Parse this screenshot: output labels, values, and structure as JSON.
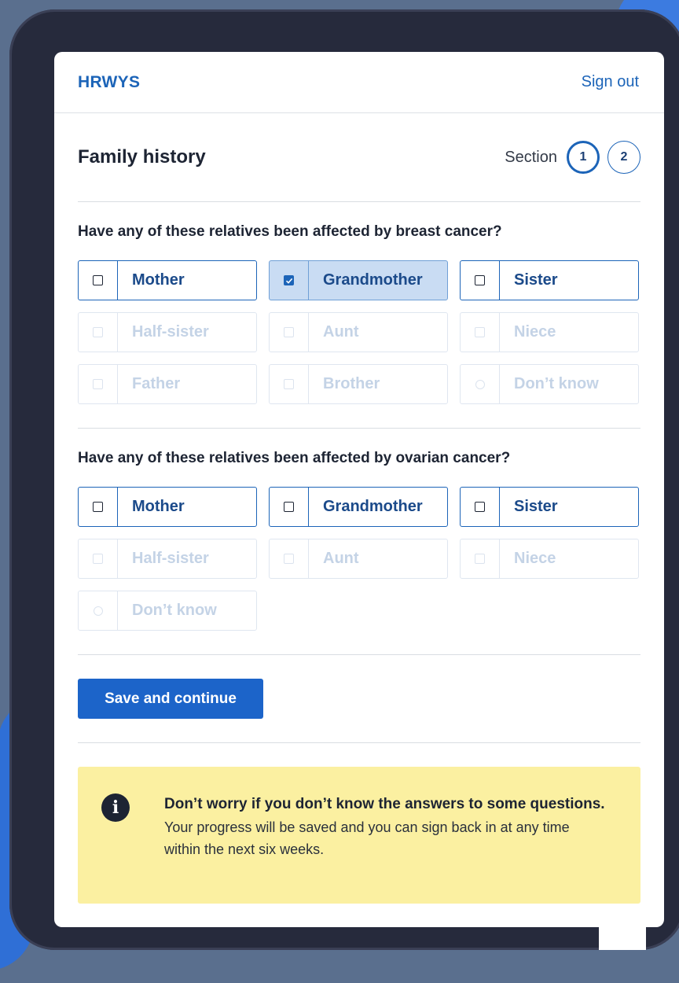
{
  "header": {
    "brand": "HRWYS",
    "sign_out": "Sign out"
  },
  "page": {
    "title": "Family history",
    "section_label": "Section",
    "steps": [
      {
        "number": "1",
        "current": true
      },
      {
        "number": "2",
        "current": false
      }
    ]
  },
  "questions": [
    {
      "text": "Have any of these relatives been affected by breast cancer?",
      "options": [
        {
          "label": "Mother",
          "state": "unchecked"
        },
        {
          "label": "Grandmother",
          "state": "checked"
        },
        {
          "label": "Sister",
          "state": "unchecked"
        },
        {
          "label": "Half-sister",
          "state": "disabled"
        },
        {
          "label": "Aunt",
          "state": "disabled"
        },
        {
          "label": "Niece",
          "state": "disabled"
        },
        {
          "label": "Father",
          "state": "disabled"
        },
        {
          "label": "Brother",
          "state": "disabled"
        },
        {
          "label": "Don’t know",
          "state": "disabled-radio"
        }
      ]
    },
    {
      "text": "Have any of these relatives been affected by ovarian cancer?",
      "options": [
        {
          "label": "Mother",
          "state": "unchecked"
        },
        {
          "label": "Grandmother",
          "state": "unchecked"
        },
        {
          "label": "Sister",
          "state": "unchecked"
        },
        {
          "label": "Half-sister",
          "state": "disabled"
        },
        {
          "label": "Aunt",
          "state": "disabled"
        },
        {
          "label": "Niece",
          "state": "disabled"
        },
        {
          "label": "Don’t know",
          "state": "disabled-radio"
        }
      ]
    }
  ],
  "actions": {
    "save_label": "Save and continue"
  },
  "info": {
    "icon": "info-icon",
    "glyph": "i",
    "title": "Don’t worry if you don’t know the answers to some questions.",
    "body": "Your progress will be saved and you can sign back in at any time within the next six weeks."
  },
  "colors": {
    "brand_blue": "#1c64b8",
    "button_blue": "#1c64c9",
    "selected_bg": "#c9dcf3",
    "info_bg": "#fbf0a1",
    "device_frame": "#262a3c"
  }
}
